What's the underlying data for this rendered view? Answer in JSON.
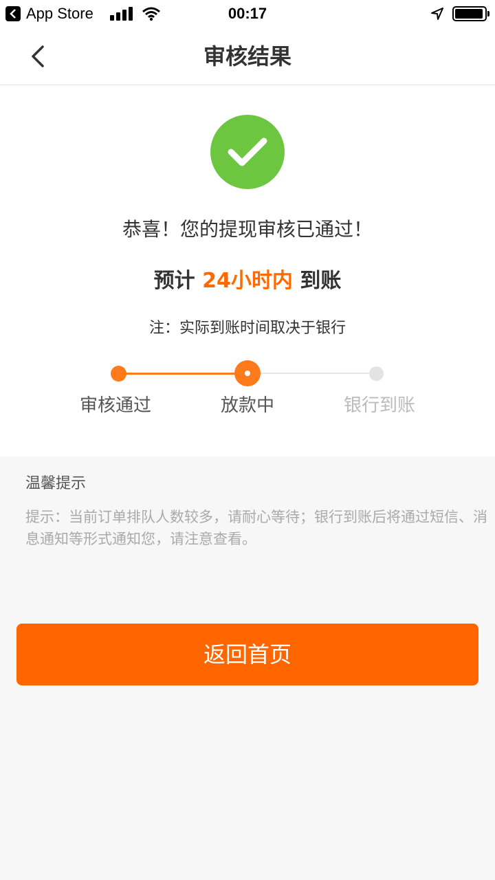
{
  "status_bar": {
    "back_app": "App Store",
    "time": "00:17"
  },
  "nav": {
    "title": "审核结果"
  },
  "result": {
    "congrats": "恭喜！您的提现审核已通过！",
    "eta_prefix": "预计 ",
    "eta_highlight": "24小时内",
    "eta_suffix": " 到账",
    "note": "注：实际到账时间取决于银行"
  },
  "steps": [
    {
      "label": "审核通过",
      "state": "done"
    },
    {
      "label": "放款中",
      "state": "current"
    },
    {
      "label": "银行到账",
      "state": "pending"
    }
  ],
  "tips": {
    "title": "温馨提示",
    "text": "提示：当前订单排队人数较多，请耐心等待；银行到账后将通过短信、消息通知等形式通知您，请注意查看。"
  },
  "button": {
    "label": "返回首页"
  },
  "colors": {
    "accent": "#ff6600",
    "success": "#6cc63f",
    "pending": "#e3e3e3"
  }
}
